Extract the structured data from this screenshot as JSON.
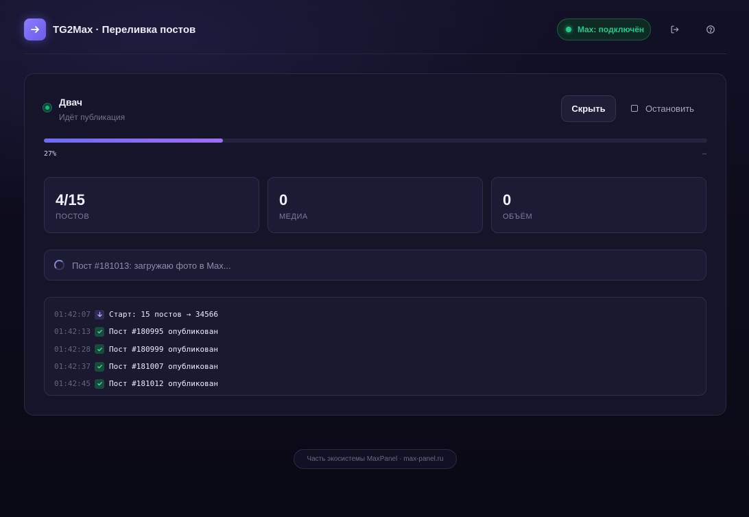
{
  "app": {
    "title": "TG2Max · Переливка постов",
    "logo_icon": "arrow-right-icon"
  },
  "header": {
    "status_text": "Max: подключён",
    "status_color": "#22c98a",
    "logout_icon": "logout-icon",
    "help_icon": "help-circle-icon"
  },
  "job": {
    "name": "Двач",
    "status": "Идёт публикация",
    "hide_label": "Скрыть",
    "stop_label": "Остановить",
    "progress": 0.27,
    "progress_label": "27%",
    "eta": "–"
  },
  "stats": [
    {
      "value": "4/15",
      "label": "ПОСТОВ"
    },
    {
      "value": "0",
      "label": "МЕДИА"
    },
    {
      "value": "0",
      "label": "ОБЪЁМ"
    }
  ],
  "current": {
    "text": "Пост #181013: загружаю фото в Max..."
  },
  "log": [
    {
      "time": "01:42:07",
      "type": "start",
      "icon": "arrow-down-icon",
      "message": "Старт: 15 постов → 34566"
    },
    {
      "time": "01:42:13",
      "type": "ok",
      "icon": "check-icon",
      "message": "Пост #180995 опубликован"
    },
    {
      "time": "01:42:28",
      "type": "ok",
      "icon": "check-icon",
      "message": "Пост #180999 опубликован"
    },
    {
      "time": "01:42:37",
      "type": "ok",
      "icon": "check-icon",
      "message": "Пост #181007 опубликован"
    },
    {
      "time": "01:42:45",
      "type": "ok",
      "icon": "check-icon",
      "message": "Пост #181012 опубликован"
    }
  ],
  "footer": {
    "text": "Часть экосистемы MaxPanel · max-panel.ru"
  }
}
